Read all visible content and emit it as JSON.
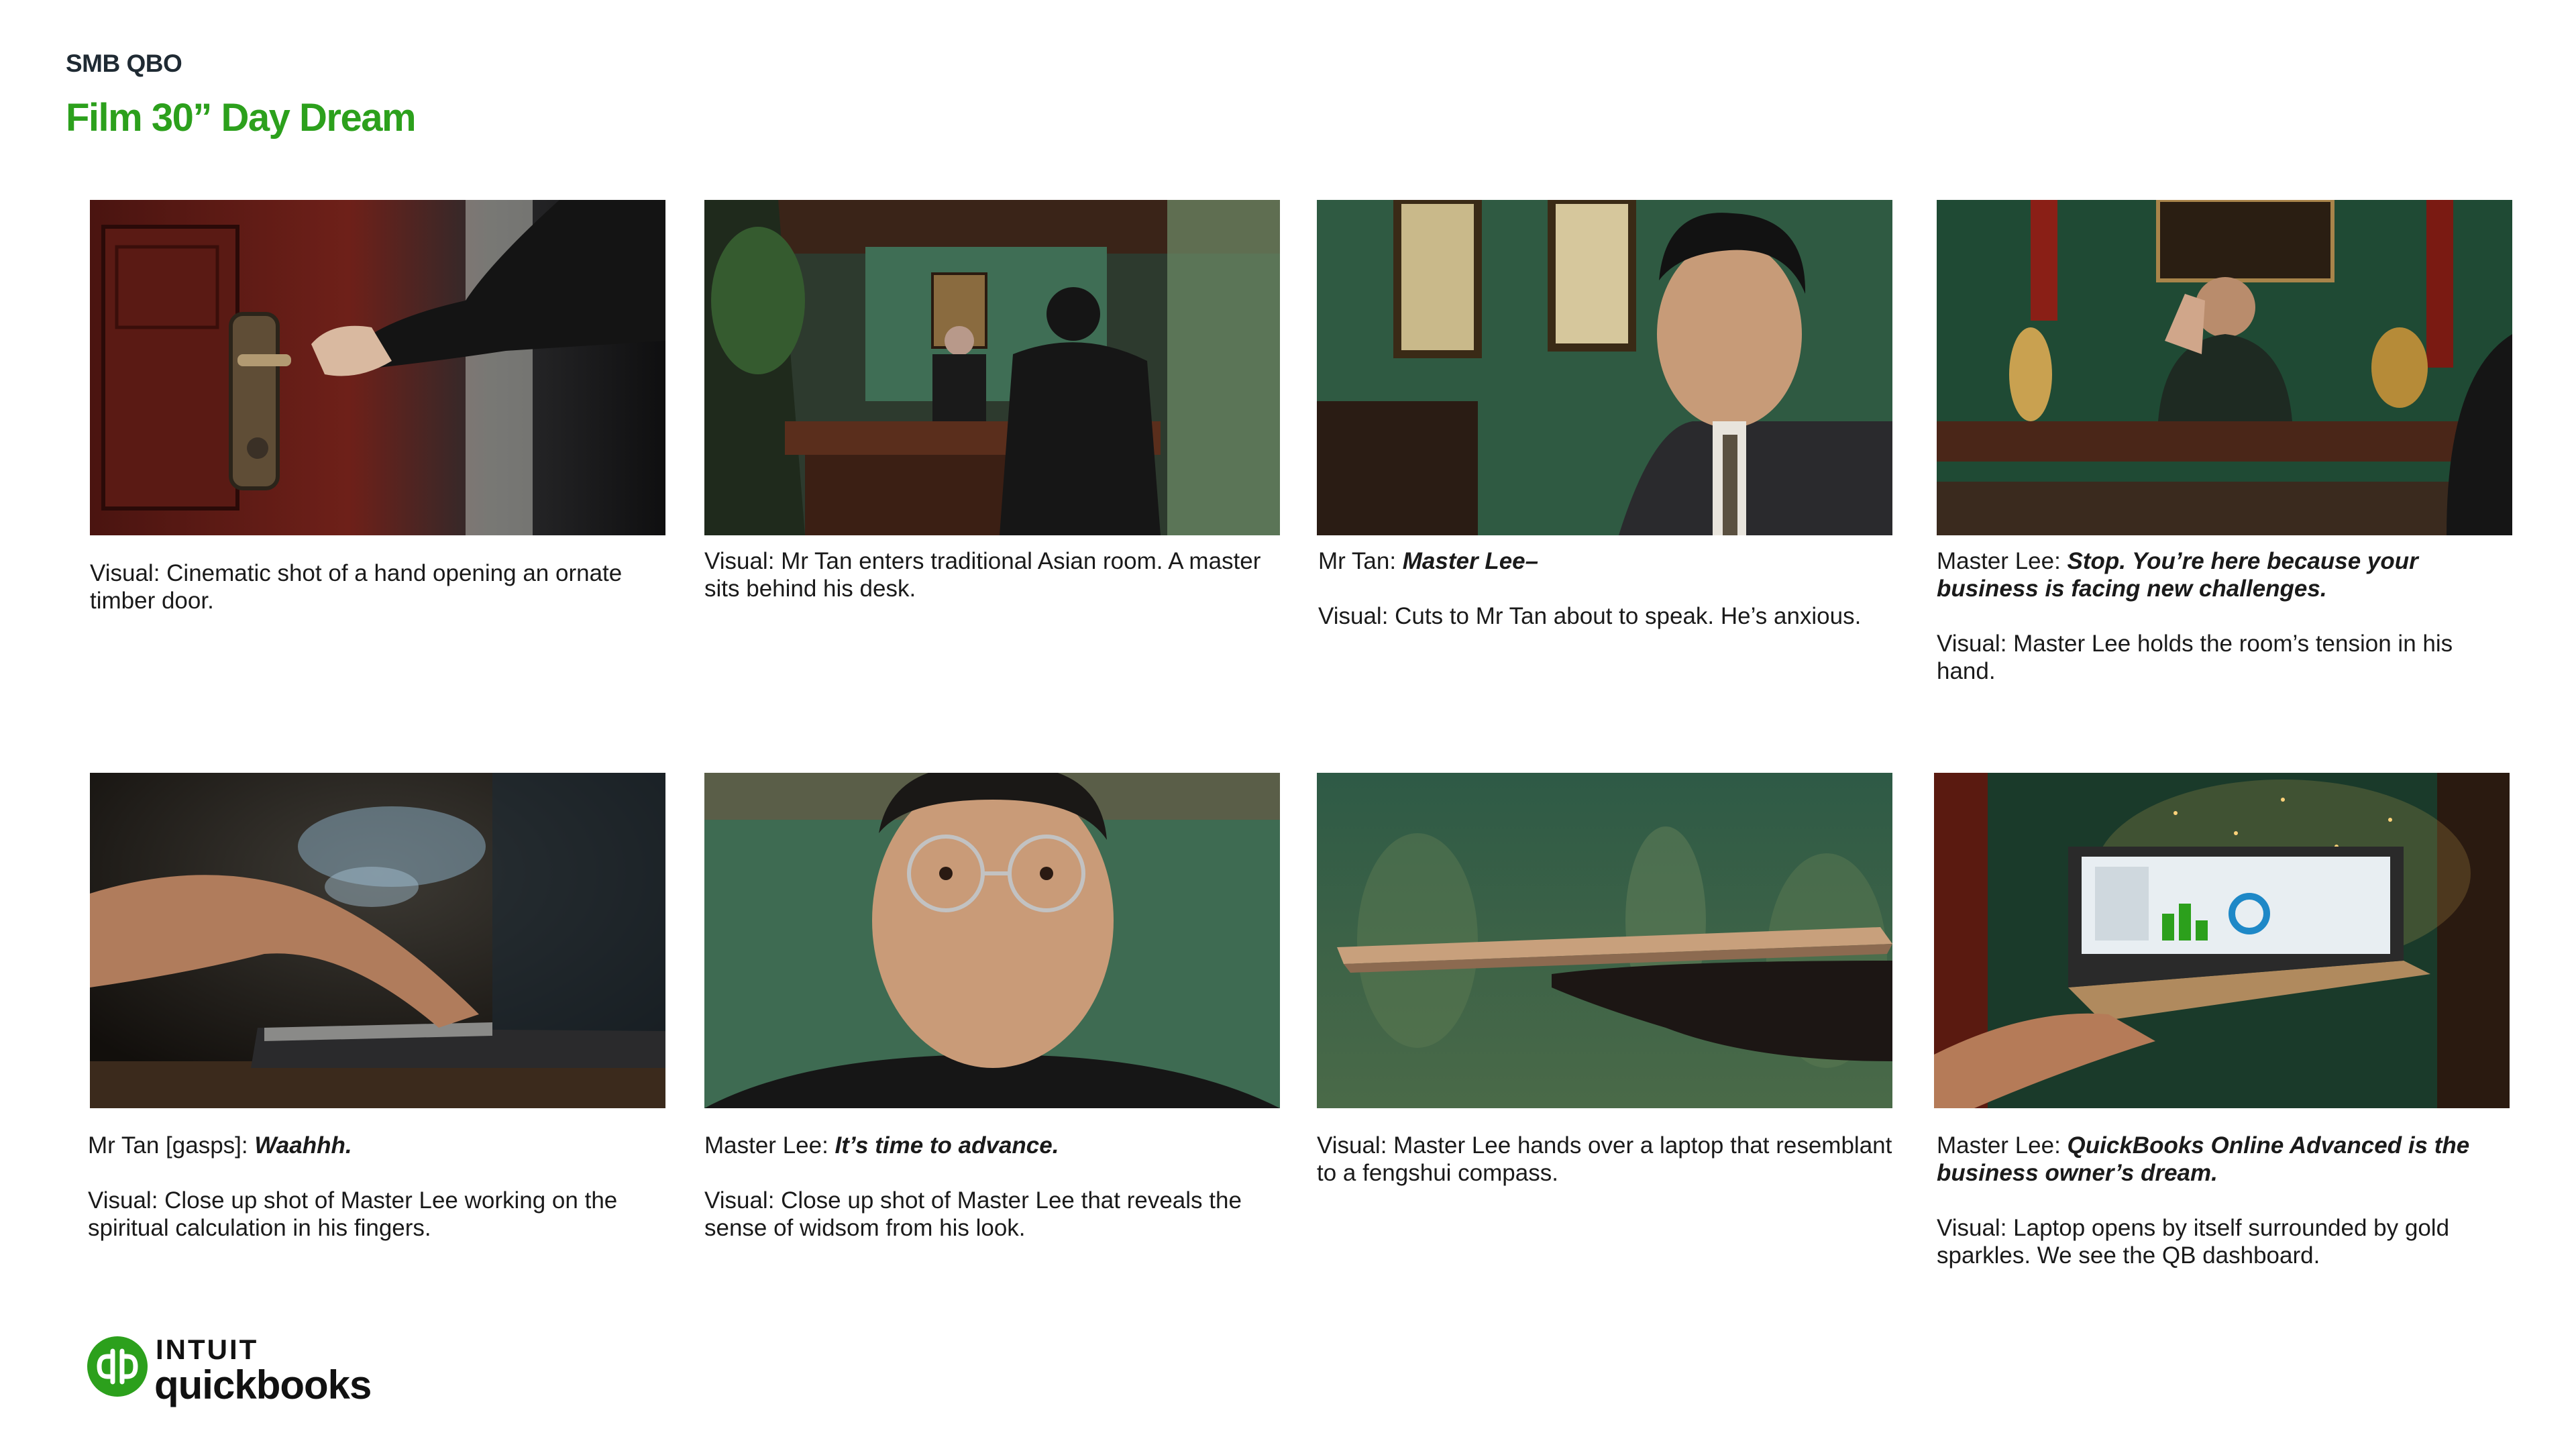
{
  "header": {
    "eyebrow": "SMB QBO",
    "title": "Film 30” Day Dream"
  },
  "frames": [
    {
      "image_alt": "hand opening an ornate timber door",
      "lines": [
        {
          "speaker": "",
          "dialogue": "",
          "text": "Visual: Cinematic shot of a hand opening an ornate timber door."
        }
      ]
    },
    {
      "image_alt": "Mr Tan enters traditional Asian room, master behind desk",
      "lines": [
        {
          "speaker": "",
          "dialogue": "",
          "text": "Visual: Mr Tan enters traditional Asian room. A master sits behind his desk."
        }
      ]
    },
    {
      "image_alt": "Mr Tan about to speak",
      "lines": [
        {
          "speaker": "Mr Tan: ",
          "dialogue": "Master Lee–",
          "text": ""
        },
        {
          "speaker": "",
          "dialogue": "",
          "text": "Visual: Cuts to Mr Tan about to speak. He’s anxious."
        }
      ]
    },
    {
      "image_alt": "Master Lee raising hand",
      "lines": [
        {
          "speaker": "Master Lee: ",
          "dialogue": "Stop. You’re here because your business is facing new challenges.",
          "text": ""
        },
        {
          "speaker": "",
          "dialogue": "",
          "text": "Visual: Master Lee holds the room’s tension in his hand."
        }
      ]
    },
    {
      "image_alt": "hand over fengshui compass with smoke",
      "lines": [
        {
          "speaker": "Mr Tan [gasps]: ",
          "dialogue": "Waahhh.",
          "text": ""
        },
        {
          "speaker": "",
          "dialogue": "",
          "text": "Visual: Close up shot of Master Lee working on the spiritual calculation in his fingers."
        }
      ]
    },
    {
      "image_alt": "close up of Master Lee with glasses",
      "lines": [
        {
          "speaker": "Master Lee:  ",
          "dialogue": "It’s time to advance.",
          "text": ""
        },
        {
          "speaker": "",
          "dialogue": "",
          "text": "Visual: Close up shot of Master Lee that reveals the sense of widsom from his look."
        }
      ]
    },
    {
      "image_alt": "hand holding closed laptop",
      "lines": [
        {
          "speaker": "",
          "dialogue": "",
          "text": "Visual: Master Lee hands over a laptop that resemblant to a fengshui compass."
        }
      ]
    },
    {
      "image_alt": "laptop opening with gold sparkles showing dashboard",
      "lines": [
        {
          "speaker": "Master Lee: ",
          "dialogue": "QuickBooks Online Advanced is the business owner’s dream.",
          "text": ""
        },
        {
          "speaker": "",
          "dialogue": "",
          "text": "Visual: Laptop opens by itself surrounded by gold sparkles. We see the QB dashboard."
        }
      ]
    }
  ],
  "logo": {
    "mark": "qb",
    "brand": "INTUIT",
    "product": "quickbooks",
    "icon": "quickbooks-logo-icon",
    "color": "#2ca01c"
  },
  "colors": {
    "accent": "#2ca01c",
    "text": "#1a1a1a"
  }
}
